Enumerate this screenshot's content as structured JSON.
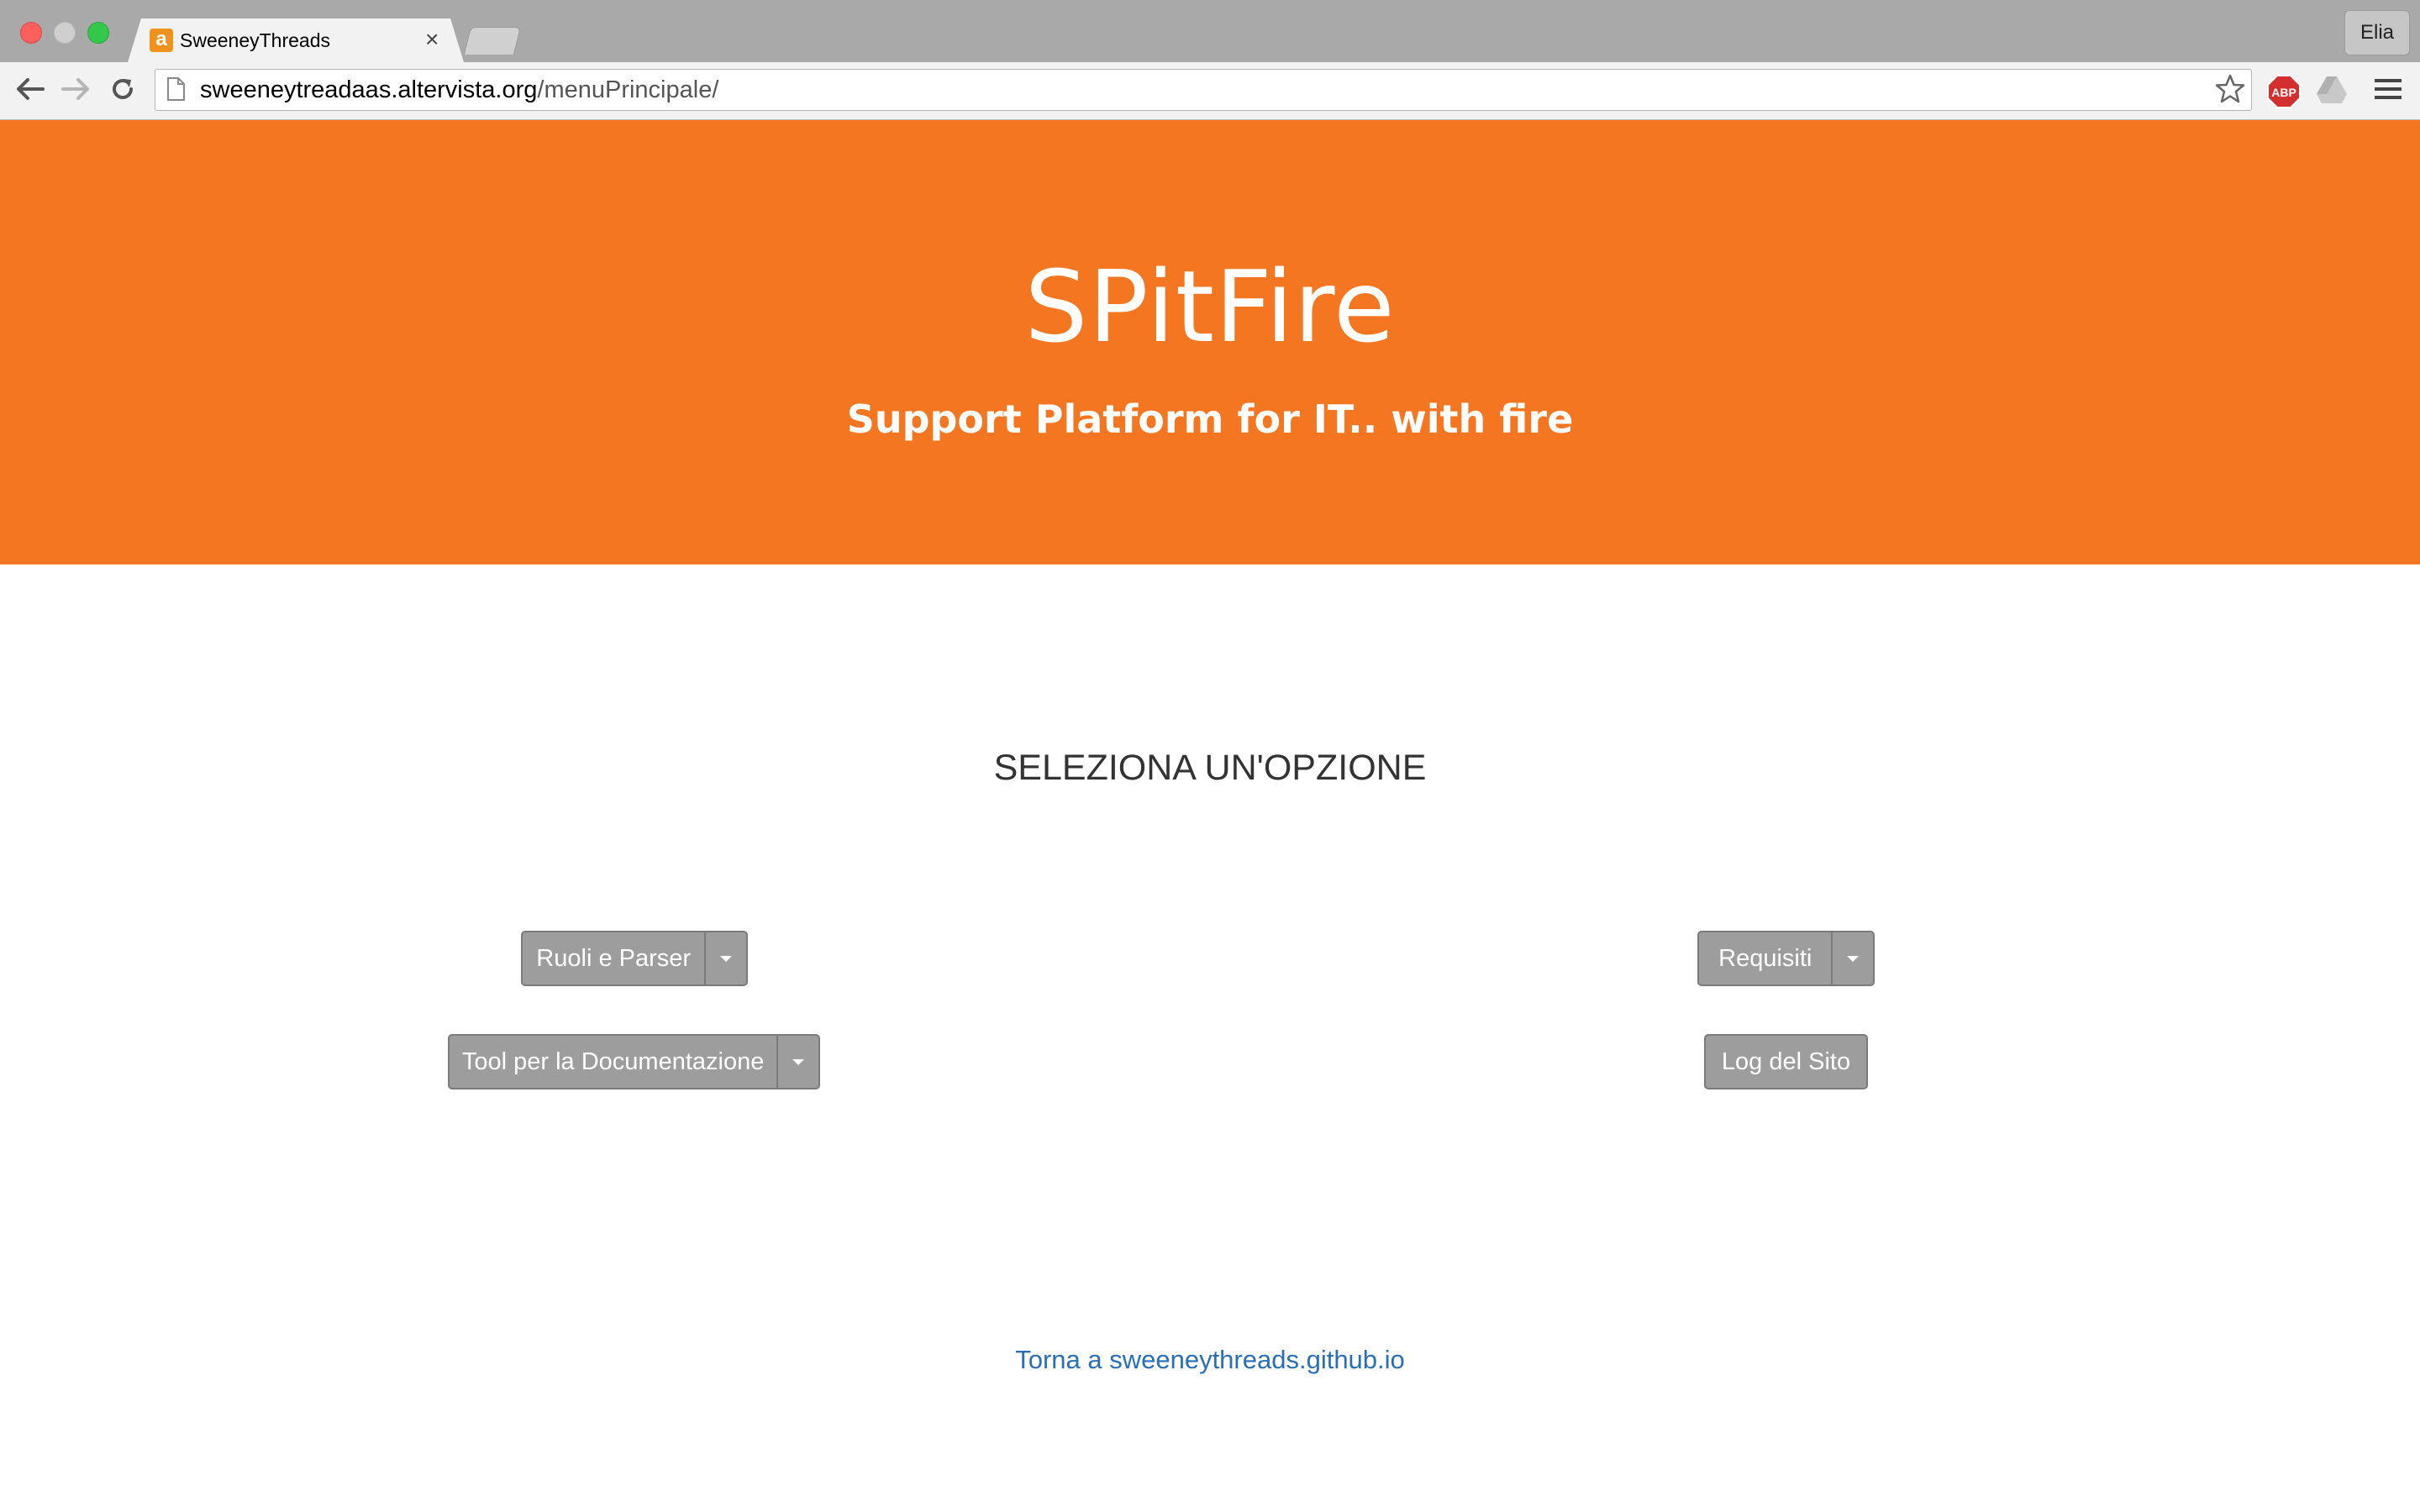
{
  "browser": {
    "tab_title": "SweeneyThreads",
    "tab_favicon_letter": "a",
    "tab_close": "×",
    "profile_name": "Elia",
    "url_host": "sweeneytreadaas.altervista.org",
    "url_path": "/menuPrincipale/",
    "extension_abp": "ABP"
  },
  "hero": {
    "title": "SPitFire",
    "subtitle": "Support Platform for IT.. with fire"
  },
  "main": {
    "heading": "SELEZIONA UN'OPZIONE",
    "buttons": {
      "ruoli_parser": "Ruoli e Parser",
      "tool_documentazione": "Tool per la Documentazione",
      "requisiti": "Requisiti",
      "log_sito": "Log del Sito"
    }
  },
  "footer": {
    "link_text": "Torna a sweeneythreads.github.io"
  },
  "colors": {
    "hero_background": "#f47620",
    "button_background": "#9d9d9d",
    "link": "#2a6fb3"
  }
}
